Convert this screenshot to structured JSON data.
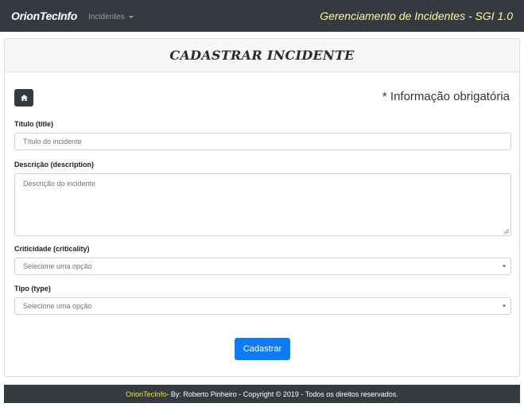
{
  "navbar": {
    "brand": "OrionTecInfo",
    "dropdown_label": "Incidentes",
    "system_title": "Gerenciamento de Incidentes - SGI 1.0"
  },
  "card": {
    "title": "CADASTRAR INCIDENTE",
    "required_note": "* Informação obrigatória",
    "home_icon": "home-icon"
  },
  "form": {
    "title_label": "Título (title)",
    "title_placeholder": "Título do incidente",
    "description_label": "Descrição (description)",
    "description_placeholder": "Descrição do incidente",
    "criticality_label": "Criticidade (criticality)",
    "criticality_value": "Selecione uma opção",
    "type_label": "Tipo (type)",
    "type_value": "Selecione uma opção",
    "submit_label": "Cadastrar"
  },
  "footer": {
    "brand": "OrionTecInfo",
    "text": " - By: Roberto Pinheiro - Copyright © 2019 - Todos os direitos reservados."
  },
  "colors": {
    "navbar_bg": "#343a40",
    "system_title": "#fcf8a6",
    "primary": "#0d7bf6",
    "footer_brand": "#e6e34a"
  }
}
